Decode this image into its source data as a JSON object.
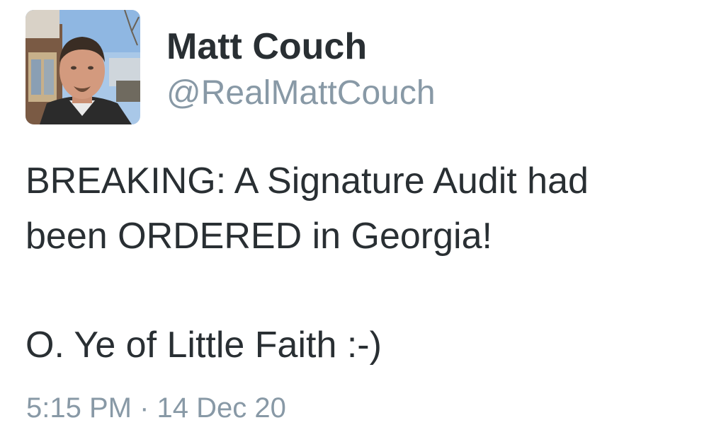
{
  "author": {
    "display_name": "Matt Couch",
    "handle": "@RealMattCouch"
  },
  "tweet": {
    "line1": "BREAKING: A Signature Audit had",
    "line2": "been ORDERED in Georgia!",
    "line3": "O. Ye of Little Faith :-)",
    "timestamp": "5:15 PM · 14 Dec 20"
  },
  "colors": {
    "text": "#292f33",
    "secondary": "#8899a6",
    "background": "#ffffff"
  }
}
